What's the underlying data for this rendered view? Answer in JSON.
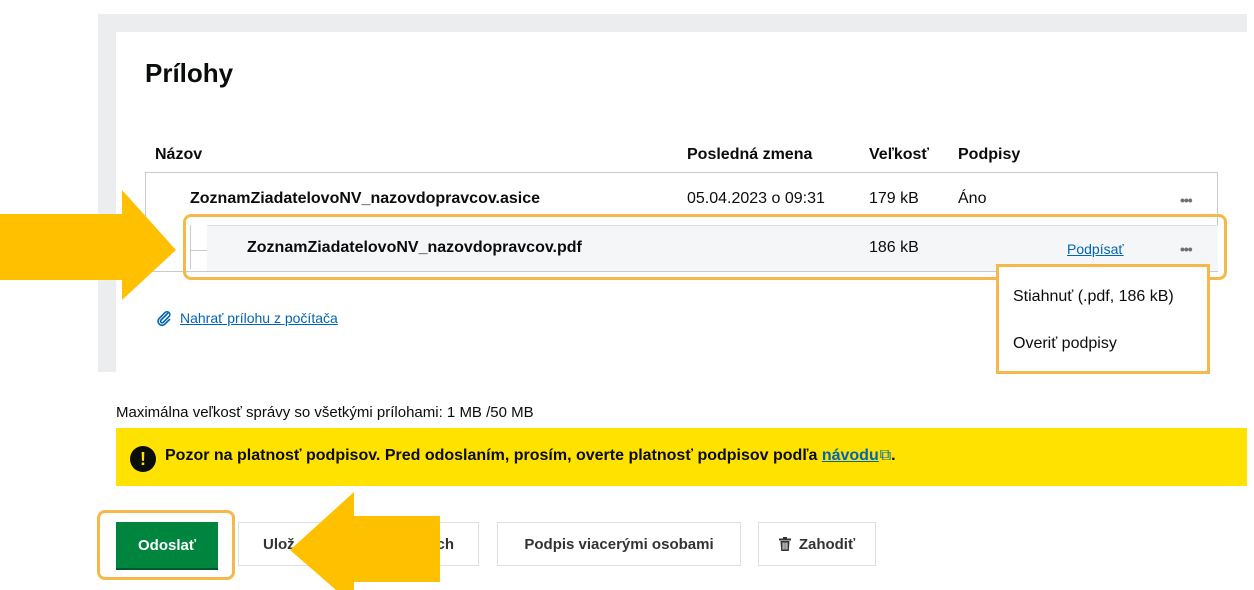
{
  "section_title": "Prílohy",
  "table": {
    "headers": {
      "name": "Názov",
      "modified": "Posledná zmena",
      "size": "Veľkosť",
      "signatures": "Podpisy"
    },
    "rows": [
      {
        "name": "ZoznamZiadatelovoNV_nazovdopravcov.asice",
        "modified": "05.04.2023 o 09:31",
        "size": "179 kB",
        "signatures": "Áno",
        "menu": "•••"
      },
      {
        "name": "ZoznamZiadatelovoNV_nazovdopravcov.pdf",
        "modified": "",
        "size": "186 kB",
        "sign_link": "Podpísať",
        "menu": "•••"
      }
    ]
  },
  "context_menu": {
    "items": [
      "Stiahnuť (.pdf, 186 kB)",
      "Overiť podpisy"
    ]
  },
  "upload_link": "Nahrať prílohu z počítača",
  "max_size_text": "Maximálna veľkosť správy so všetkými prílohami: 1 MB /50 MB",
  "warning": {
    "icon": "!",
    "text": "Pozor na platnosť podpisov. Pred odoslaním, prosím, overte platnosť podpisov podľa ",
    "link": "návodu",
    "ext_icon": "⧉",
    "end": "."
  },
  "buttons": {
    "send": "Odoslať",
    "save_left": "Ulož",
    "save_right": "ch",
    "multi_sign": "Podpis viacerými osobami",
    "discard": "Zahodiť"
  },
  "colors": {
    "annotation_orange": "#f7b84b",
    "arrow_fill": "#ffc000",
    "primary_green": "#00853f",
    "warning_yellow": "#ffe200",
    "link_blue": "#0065b3"
  }
}
